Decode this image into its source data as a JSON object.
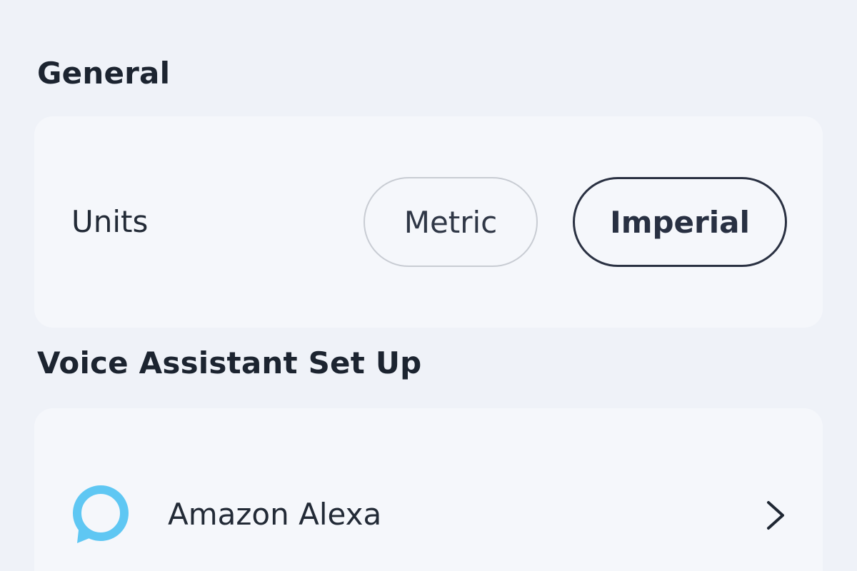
{
  "sections": {
    "general": {
      "title": "General",
      "units": {
        "label": "Units",
        "options": [
          "Metric",
          "Imperial"
        ],
        "selected": "Imperial"
      }
    },
    "voice_assistant": {
      "title": "Voice Assistant Set Up",
      "items": [
        {
          "label": "Amazon Alexa",
          "icon": "alexa-icon",
          "trailing_icon": "chevron-right-icon"
        }
      ]
    }
  },
  "colors": {
    "background": "#eff2f8",
    "card": "#f5f7fb",
    "alexa_blue": "#5fc7f3",
    "selected_border": "#2a3142",
    "unselected_border": "#c8ccd3"
  }
}
